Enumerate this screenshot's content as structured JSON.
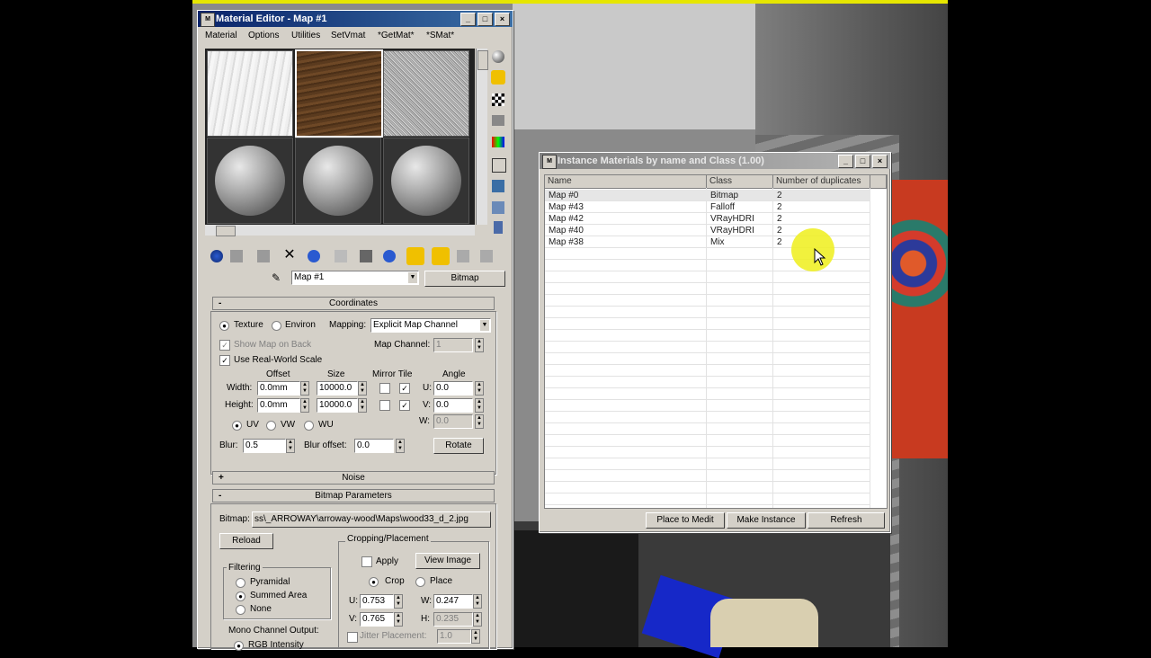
{
  "material_editor": {
    "title": "Material Editor - Map #1",
    "menu": [
      "Material",
      "Options",
      "Utilities",
      "SetVmat",
      "*GetMat*",
      "*SMat*"
    ],
    "map_name": "Map #1",
    "map_type": "Bitmap",
    "coordinates": {
      "header": "Coordinates",
      "texture_label": "Texture",
      "environ_label": "Environ",
      "mapping_label": "Mapping:",
      "mapping_value": "Explicit Map Channel",
      "show_map_label": "Show Map on Back",
      "map_channel_label": "Map Channel:",
      "map_channel_value": "1",
      "realworld_label": "Use Real-World Scale",
      "offset_header": "Offset",
      "size_header": "Size",
      "mirror_tile_header": "Mirror Tile",
      "angle_header": "Angle",
      "width_label": "Width:",
      "width_offset": "0.0mm",
      "width_size": "10000.0",
      "height_label": "Height:",
      "height_offset": "0.0mm",
      "height_size": "10000.0",
      "u_label": "U:",
      "u_angle": "0.0",
      "v_label": "V:",
      "v_angle": "0.0",
      "w_label": "W:",
      "w_angle": "0.0",
      "uv_label": "UV",
      "vw_label": "VW",
      "wu_label": "WU",
      "blur_label": "Blur:",
      "blur_value": "0.5",
      "blur_offset_label": "Blur offset:",
      "blur_offset_value": "0.0",
      "rotate_label": "Rotate"
    },
    "noise_header": "Noise",
    "bitmap_params": {
      "header": "Bitmap Parameters",
      "bitmap_label": "Bitmap:",
      "bitmap_path": "ss\\_ARROWAY\\arroway-wood\\Maps\\wood33_d_2.jpg",
      "reload_label": "Reload",
      "cropping_header": "Cropping/Placement",
      "apply_label": "Apply",
      "view_image_label": "View Image",
      "crop_label": "Crop",
      "place_label": "Place",
      "u_label": "U:",
      "u_value": "0.753",
      "w_label": "W:",
      "w_value": "0.247",
      "v_label": "V:",
      "v_value": "0.765",
      "h_label": "H:",
      "h_value": "0.235",
      "jitter_label": "Jitter Placement:",
      "jitter_value": "1.0",
      "filtering_header": "Filtering",
      "pyramidal_label": "Pyramidal",
      "summed_label": "Summed Area",
      "none_label": "None",
      "mono_header": "Mono Channel Output:",
      "rgb_label": "RGB Intensity"
    }
  },
  "instance_dialog": {
    "title": "Instance Materials by name and Class (1.00)",
    "columns": [
      "Name",
      "Class",
      "Number of duplicates"
    ],
    "rows": [
      {
        "name": "Map #0",
        "class": "Bitmap",
        "count": "2"
      },
      {
        "name": "Map #43",
        "class": "Falloff",
        "count": "2"
      },
      {
        "name": "Map #42",
        "class": "VRayHDRI",
        "count": "2"
      },
      {
        "name": "Map #40",
        "class": "VRayHDRI",
        "count": "2"
      },
      {
        "name": "Map #38",
        "class": "Mix",
        "count": "2"
      }
    ],
    "buttons": {
      "place": "Place to Medit",
      "make": "Make Instance",
      "refresh": "Refresh"
    }
  }
}
